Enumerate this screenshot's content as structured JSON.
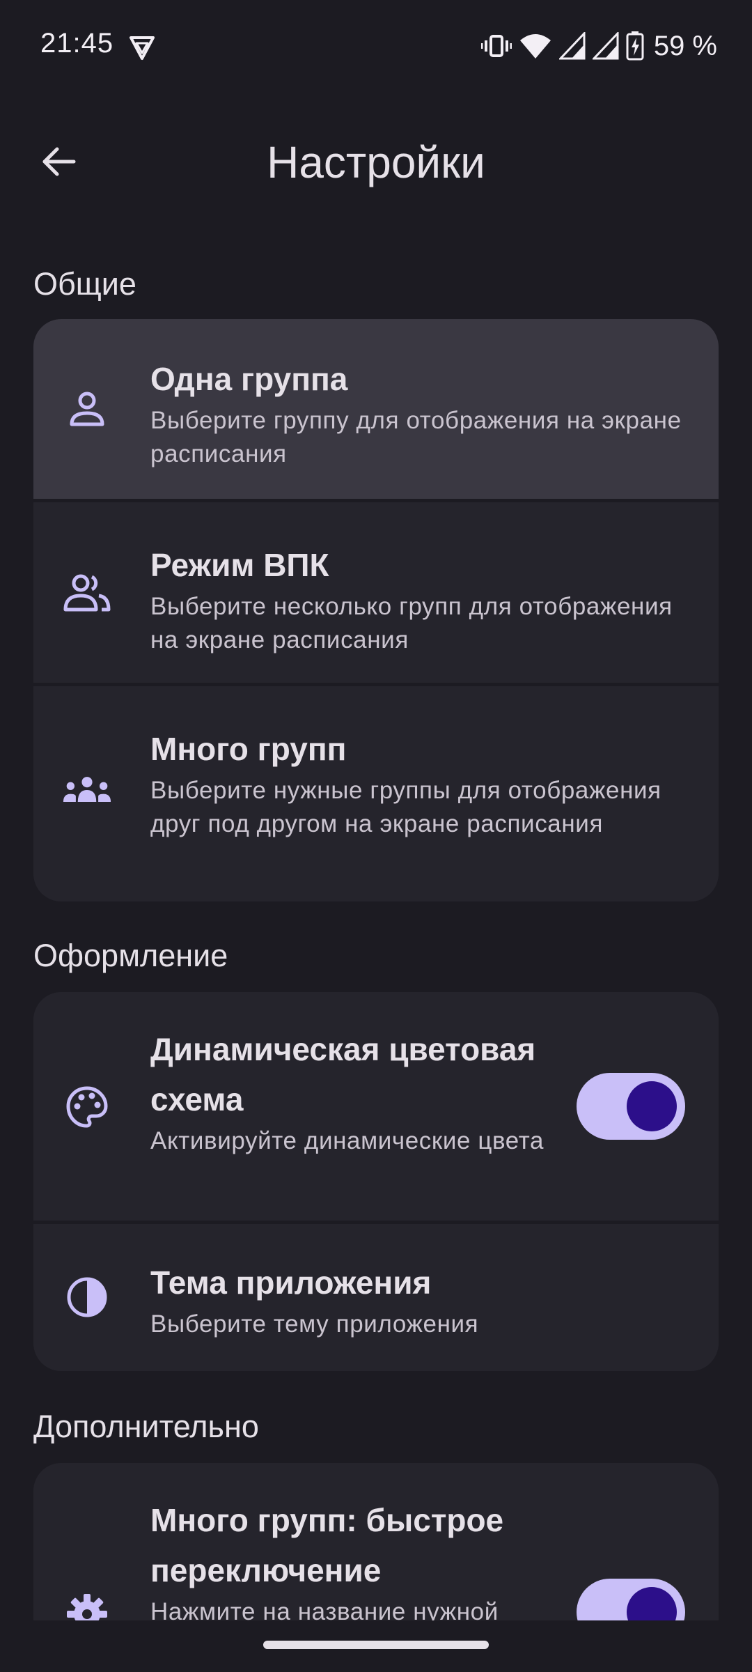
{
  "status_bar": {
    "time": "21:45",
    "battery": "59 %",
    "icons": [
      "vpn-icon",
      "vibrate-icon",
      "wifi-icon",
      "signal-icon",
      "signal-icon",
      "battery-charging-icon"
    ]
  },
  "app_bar": {
    "title": "Настройки",
    "back_icon": "arrow-back-icon"
  },
  "sections": {
    "general": {
      "header": "Общие",
      "items": [
        {
          "icon": "person-icon",
          "title": "Одна группа",
          "subtitle": "Выберите группу для отображения на экране расписания",
          "highlighted": true
        },
        {
          "icon": "people-icon",
          "title": "Режим ВПК",
          "subtitle": "Выберите несколько групп для отображения на экране расписания"
        },
        {
          "icon": "groups-icon",
          "title": "Много групп",
          "subtitle": "Выберите нужные группы для отображения друг под другом на экране расписания"
        }
      ]
    },
    "appearance": {
      "header": "Оформление",
      "items": [
        {
          "icon": "palette-icon",
          "title": "Динамическая цветовая схема",
          "subtitle": "Активируйте динамические цвета",
          "toggle": true,
          "toggle_on": true
        },
        {
          "icon": "contrast-icon",
          "title": "Тема приложения",
          "subtitle": "Выберите тему приложения"
        }
      ]
    },
    "extra": {
      "header": "Дополнительно",
      "items": [
        {
          "icon": "gear-icon",
          "title": "Много групп: быстрое переключение",
          "subtitle": "Нажмите на название нужной",
          "toggle": true,
          "toggle_on": true
        }
      ]
    }
  },
  "colors": {
    "background": "#1c1b22",
    "card": "#25242c",
    "highlight": "#3a3842",
    "accent": "#c9bff8",
    "toggle_thumb": "#2c0f8a"
  }
}
